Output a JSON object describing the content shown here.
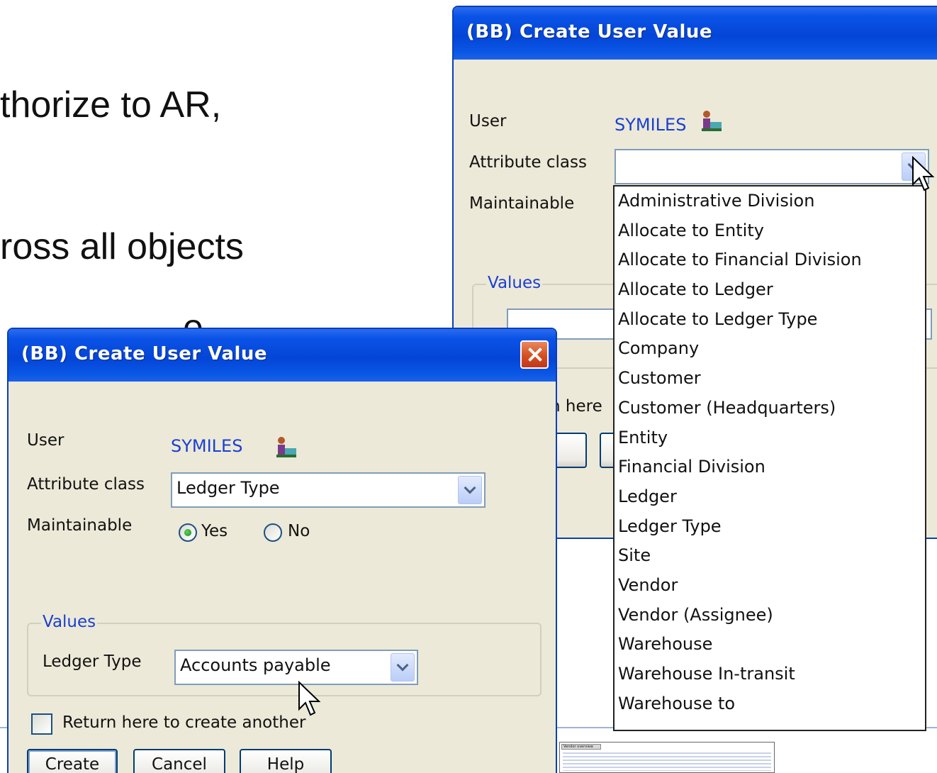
{
  "slide": {
    "line1": "thorize to AR,",
    "line2": "ross all objects",
    "line3": "e"
  },
  "back_window": {
    "title": "(BB) Create User Value",
    "user_label": "User",
    "user_value": "SYMILES",
    "attribute_class_label": "Attribute class",
    "attribute_class_value": "",
    "maintainable_label": "Maintainable",
    "values_legend": "Values",
    "return_fragment": "h here"
  },
  "dropdown": {
    "options": [
      "Administrative Division",
      "Allocate to Entity",
      "Allocate to Financial Division",
      "Allocate to Ledger",
      "Allocate to Ledger Type",
      "Company",
      "Customer",
      "Customer (Headquarters)",
      "Entity",
      "Financial Division",
      "Ledger",
      "Ledger Type",
      "Site",
      "Vendor",
      "Vendor (Assignee)",
      "Warehouse",
      "Warehouse In-transit",
      "Warehouse to"
    ]
  },
  "front_window": {
    "title": "(BB) Create User Value",
    "user_label": "User",
    "user_value": "SYMILES",
    "attribute_class_label": "Attribute class",
    "attribute_class_value": "Ledger Type",
    "maintainable_label": "Maintainable",
    "radio_yes": "Yes",
    "radio_no": "No",
    "maintainable_selected": "Yes",
    "values_legend": "Values",
    "ledger_type_label": "Ledger Type",
    "ledger_type_value": "Accounts payable",
    "return_checkbox_label": "Return here to create another",
    "return_checkbox_checked": false,
    "create_button": "Create",
    "cancel_button": "Cancel",
    "help_button": "Help"
  },
  "thumbnail": {
    "tab_label": "Vendor overview"
  },
  "colors": {
    "titlebar": "#0445d7",
    "window_face": "#ece9d8",
    "user_value": "#1a3fd1",
    "close_button": "#d54e20"
  }
}
